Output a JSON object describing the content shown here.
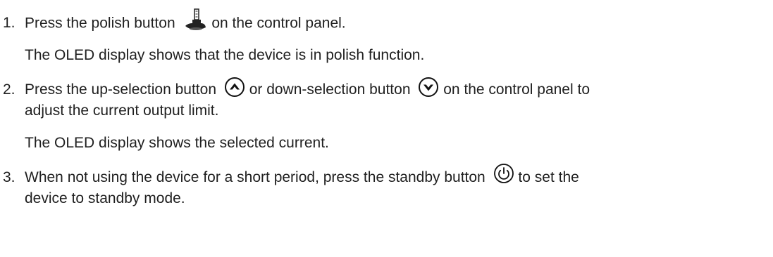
{
  "steps": [
    {
      "number": "1.",
      "line1_before": "Press the polish button",
      "line1_after": " on the control panel.",
      "icon": "polish-icon",
      "result": "The OLED display shows that the device is in polish function."
    },
    {
      "number": "2.",
      "line1_part1": "Press the up-selection button",
      "line1_part2": " or down-selection button",
      "line1_part3": " on the control panel to",
      "line2": "adjust the current output limit.",
      "icons": [
        "up-selection-icon",
        "down-selection-icon"
      ],
      "result": "The OLED display shows the selected current."
    },
    {
      "number": "3.",
      "line1_before": "When not using the device for a short period, press the standby button",
      "line1_after": " to set the",
      "line2": "device to standby mode.",
      "icon": "standby-icon"
    }
  ]
}
